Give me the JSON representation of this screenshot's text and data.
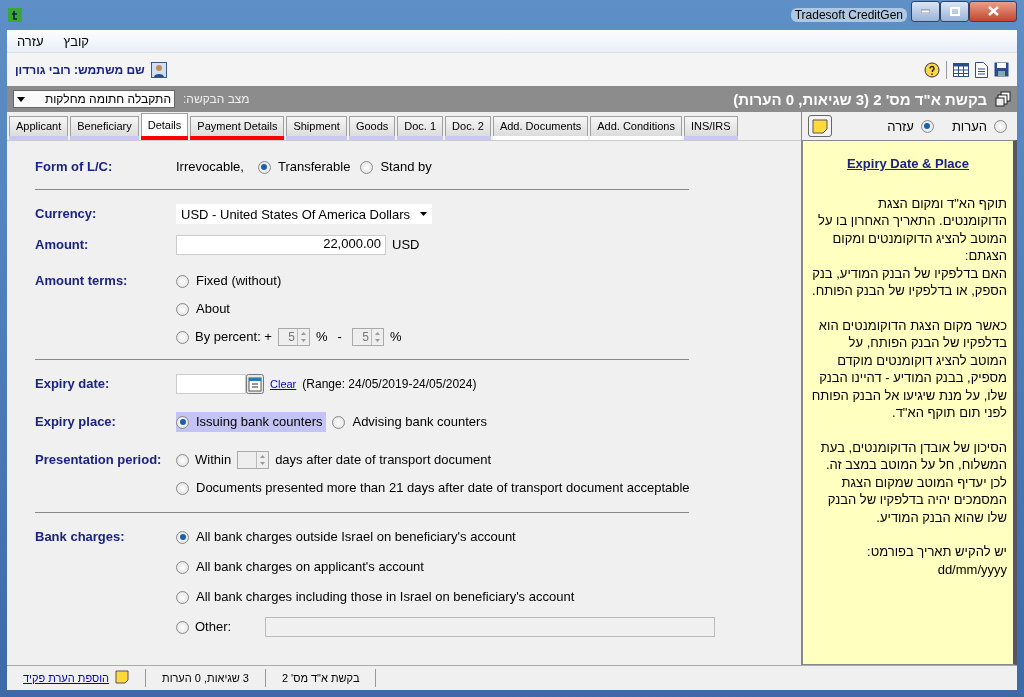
{
  "window": {
    "title": "Tradesoft CreditGen"
  },
  "menu": [
    "קובץ",
    "עזרה"
  ],
  "user": {
    "label": "שם משתמש: רובי גורדון"
  },
  "header": {
    "title": "בקשת א\"ד מס' 2 (3 שגיאות, 0 הערות)",
    "status_label": "מצב הבקשה:",
    "status_value": "התקבלה חתומה מחלקות"
  },
  "tabs": [
    {
      "label": "INS/IRS",
      "selected": false,
      "color": "#c8c8f0"
    },
    {
      "label": "Add. Conditions",
      "selected": false,
      "color": "#ffffff"
    },
    {
      "label": "Add. Documents",
      "selected": false,
      "color": "#ffffff"
    },
    {
      "label": "Doc. 2",
      "selected": false,
      "color": "#c8c8f0"
    },
    {
      "label": "Doc. 1",
      "selected": false,
      "color": "#c8c8f0"
    },
    {
      "label": "Goods",
      "selected": false,
      "color": "#c8c8f0"
    },
    {
      "label": "Shipment",
      "selected": false,
      "color": "#c8c8f0"
    },
    {
      "label": "Payment Details",
      "selected": false,
      "color": "#ff0000"
    },
    {
      "label": "Details",
      "selected": true,
      "color": "#ff0000"
    },
    {
      "label": "Beneficiary",
      "selected": false,
      "color": "#c8c8f0"
    },
    {
      "label": "Applicant",
      "selected": false,
      "color": "#c8c8f0"
    }
  ],
  "form": {
    "form_of_lc": {
      "label": "Form of L/C:",
      "prefix": "Irrevocable,",
      "options": [
        {
          "label": "Stand by",
          "selected": false
        },
        {
          "label": "Transferable",
          "selected": true
        }
      ]
    },
    "currency": {
      "label": "Currency:",
      "value": "USD - United States Of America Dollars"
    },
    "amount": {
      "label": "Amount:",
      "value": "22,000.00",
      "unit": "USD"
    },
    "amount_terms": {
      "label": "Amount terms:",
      "options": [
        {
          "kind": "plain",
          "label": "Fixed (without)",
          "selected": false
        },
        {
          "kind": "plain",
          "label": "About",
          "selected": false
        },
        {
          "kind": "percent",
          "label": "By percent: +",
          "selected": false,
          "plus_value": "5",
          "plus_unit": "%",
          "minus_sign": "-",
          "minus_value": "5",
          "minus_unit": "%"
        }
      ]
    },
    "expiry_date": {
      "label": "Expiry date:",
      "clear": "Clear",
      "range": "(Range: 24/05/2019-24/05/2024)"
    },
    "expiry_place": {
      "label": "Expiry place:",
      "options": [
        {
          "label": "Advising bank counters",
          "selected": false
        },
        {
          "label": "Issuing bank counters",
          "selected": true
        }
      ]
    },
    "presentation_period": {
      "label": "Presentation period:",
      "options": [
        {
          "kind": "within",
          "label": "Within",
          "suffix": "days after date of transport document",
          "selected": false
        },
        {
          "kind": "plain",
          "label": "Documents presented more than 21 days after date of transport document acceptable",
          "selected": false
        }
      ]
    },
    "bank_charges": {
      "label": "Bank charges:",
      "options": [
        {
          "kind": "plain",
          "label": "All bank charges outside Israel on beneficiary's account",
          "selected": true
        },
        {
          "kind": "plain",
          "label": "All bank charges on applicant's account",
          "selected": false
        },
        {
          "kind": "plain",
          "label": "All bank charges including those in Israel on beneficiary's account",
          "selected": false
        },
        {
          "kind": "other",
          "label": "Other:",
          "selected": false
        }
      ]
    }
  },
  "side_panel": {
    "options": [
      {
        "label": "הערות",
        "selected": false
      },
      {
        "label": "עזרה",
        "selected": true
      }
    ],
    "help_title": "Expiry Date & Place",
    "help_blocks": [
      [
        "תוקף הא\"ד ומקום הצגת הדוקומנטים. התאריך האחרון בו על המוטב להציג הדוקומנטים ומקום הצגתם:",
        "האם בדלפקיו של הבנק המודיע, בנק הספק, או בדלפקיו של הבנק הפותח."
      ],
      [
        "כאשר מקום הצגת הדוקומנטים הוא בדלפקיו של הבנק הפותח, על המוטב להציג דוקומנטים מוקדם מספיק, בבנק המודיע - דהיינו הבנק שלו, על מנת שיגיעו אל הבנק הפותח לפני תום תוקף הא\"ד."
      ],
      [
        "הסיכון של אובדן הדוקומנטים, בעת המשלוח, חל על המוטב במצב זה. לכן יעדיף המוטב שמקום הצגת המסמכים יהיה בדלפקיו של הבנק שלו שהוא  הבנק המודיע."
      ],
      [
        "יש להקיש תאריך בפורמט:",
        "dd/mm/yyyy"
      ]
    ]
  },
  "status_bar": {
    "link": "הוספת הערת פקיד",
    "errors": "3 שגיאות, 0 הערות",
    "request": "בקשת א\"ד מס' 2"
  }
}
